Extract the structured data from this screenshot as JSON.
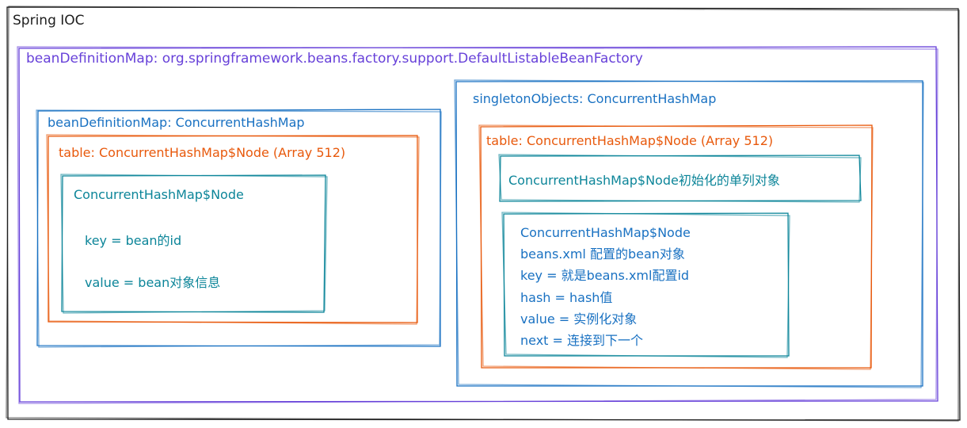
{
  "diagram": {
    "outer": {
      "title": "Spring IOC"
    },
    "factory": {
      "title": "beanDefinitionMap: org.springframework.beans.factory.support.DefaultListableBeanFactory"
    },
    "bean_definition_map": {
      "title": "beanDefinitionMap: ConcurrentHashMap",
      "table": {
        "title": "table: ConcurrentHashMap$Node (Array 512)",
        "node": {
          "title": "ConcurrentHashMap$Node",
          "key_line": "key = bean的id",
          "value_line": "value = bean对象信息"
        }
      }
    },
    "singleton_objects": {
      "title": "singletonObjects: ConcurrentHashMap",
      "table": {
        "title": "table: ConcurrentHashMap$Node (Array 512)",
        "init_note": "ConcurrentHashMap$Node初始化的单列对象",
        "node": {
          "lines": [
            "ConcurrentHashMap$Node",
            "beans.xml 配置的bean对象",
            "key = 就是beans.xml配置id",
            "hash = hash值",
            "value = 实例化对象",
            "next = 连接到下一个"
          ]
        }
      }
    },
    "colors": {
      "outer": "#1e1e1e",
      "factory": "#6741d9",
      "map": "#1971c2",
      "table": "#e8590c",
      "node": "#0c8599"
    }
  }
}
